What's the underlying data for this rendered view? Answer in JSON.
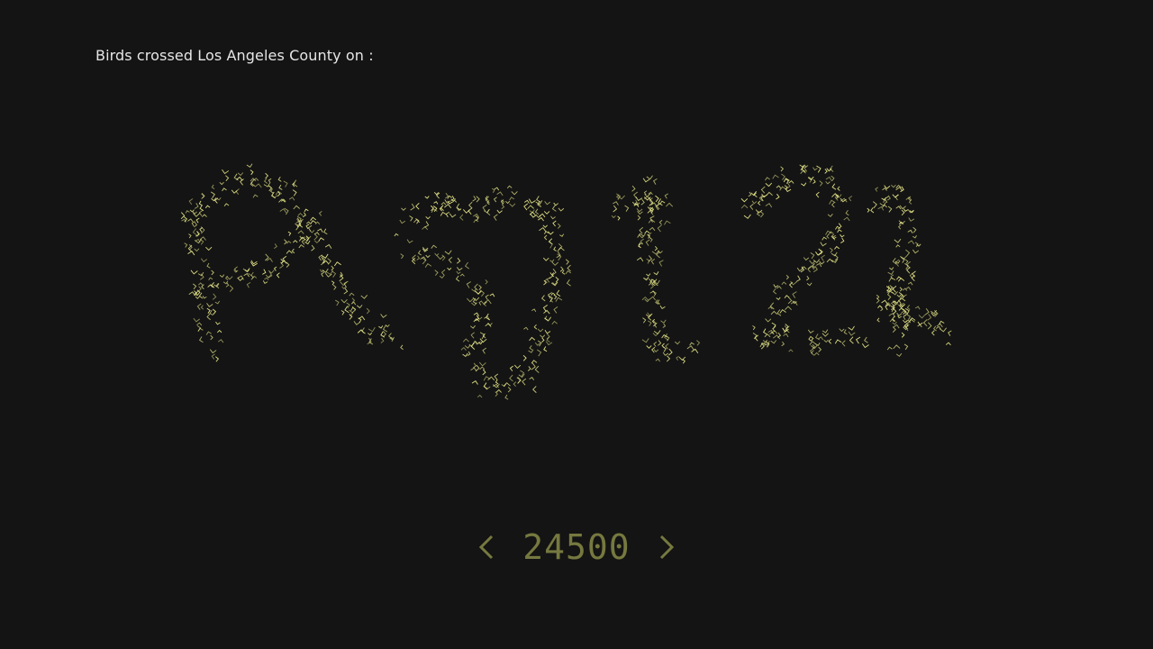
{
  "header": {
    "caption": "Birds crossed Los Angeles County on :"
  },
  "flock": {
    "color": "#e8e88a",
    "icon": "bird-chevron-icon"
  },
  "counter": {
    "value": "24500",
    "color": "#76793f",
    "prev_icon": "chevron-left-icon",
    "next_icon": "chevron-right-icon"
  }
}
